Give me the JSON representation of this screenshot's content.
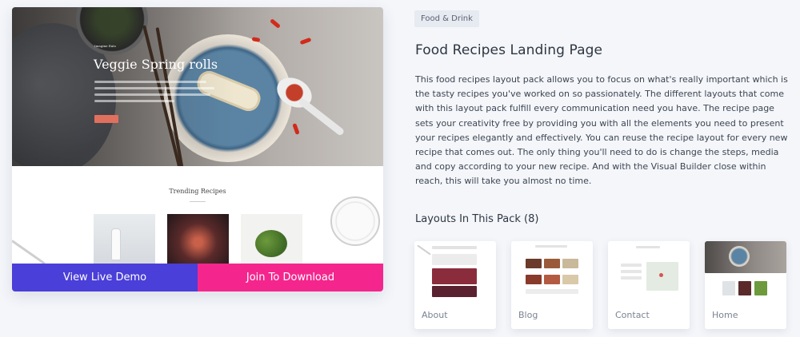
{
  "preview": {
    "hero_small_caption": "Imagine Eats",
    "hero_title": "Veggie Spring rolls",
    "trending_title": "Trending Recipes"
  },
  "actions": {
    "view_demo": "View Live Demo",
    "join_download": "Join To Download"
  },
  "category_tag": "Food & Drink",
  "title": "Food Recipes Landing Page",
  "description": "This food recipes layout pack allows you to focus on what's really important which is the tasty recipes you've worked on so passionately. The different layouts that come with this layout pack fulfill every communication need you have. The recipe page sets your creativity free by providing you with all the elements you need to present your recipes elegantly and effectively. You can reuse the recipe layout for every new recipe that comes out. The only thing you'll need to do is change the steps, media and copy according to your new recipe. And with the Visual Builder close within reach, this will take you almost no time.",
  "layouts": {
    "heading": "Layouts In This Pack (8)",
    "items": [
      {
        "label": "About"
      },
      {
        "label": "Blog"
      },
      {
        "label": "Contact"
      },
      {
        "label": "Home"
      }
    ]
  },
  "colors": {
    "demo_button": "#4a3fd8",
    "download_button": "#f4268d",
    "page_bg": "#f4f6fa"
  }
}
